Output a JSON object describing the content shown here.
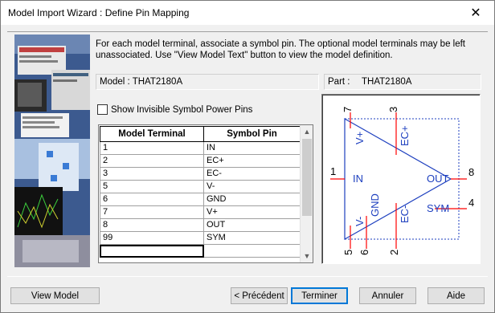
{
  "window": {
    "title": "Model Import Wizard : Define Pin Mapping",
    "close_glyph": "✕"
  },
  "instructions": "For each model terminal, associate a symbol pin. The optional model terminals may be left unassociated. Use \"View Model Text\" button to view the model definition.",
  "model_info": {
    "label": "Model : THAT2180A"
  },
  "part_info": {
    "label": "Part :",
    "value": "THAT2180A"
  },
  "show_power_pins": {
    "label": "Show Invisible Symbol Power Pins",
    "checked": false
  },
  "grid": {
    "headers": [
      "Model Terminal",
      "Symbol Pin"
    ],
    "rows": [
      [
        "1",
        "IN"
      ],
      [
        "2",
        "EC+"
      ],
      [
        "3",
        "EC-"
      ],
      [
        "5",
        "V-"
      ],
      [
        "6",
        "GND"
      ],
      [
        "7",
        "V+"
      ],
      [
        "8",
        "OUT"
      ],
      [
        "99",
        "SYM"
      ],
      [
        "",
        ""
      ]
    ]
  },
  "symbol": {
    "pins": {
      "p1": "1",
      "p7": "7",
      "p3": "3",
      "p8": "8",
      "p4": "4",
      "p5": "5",
      "p6": "6",
      "p2": "2"
    },
    "labels": {
      "in": "IN",
      "out": "OUT",
      "sym": "SYM",
      "vplus": "V+",
      "vminus": "V-",
      "ecplus": "EC+",
      "ecminus": "EC-",
      "gnd": "GND"
    },
    "color_lines": "#ff0000",
    "color_labels": "#1d3fbf",
    "color_body": "#1d3fbf"
  },
  "buttons": {
    "view_model": "View Model",
    "back": "< Précédent",
    "finish": "Terminer",
    "cancel": "Annuler",
    "help": "Aide"
  }
}
